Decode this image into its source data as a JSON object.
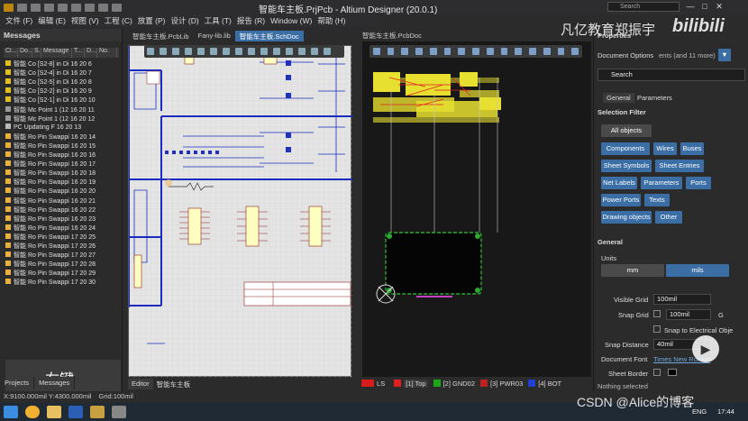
{
  "window": {
    "title": "智能车主板.PrjPcb - Altium Designer (20.0.1)",
    "search_placeholder": "Search",
    "close": "✕",
    "maximize": "□",
    "minimize": "—"
  },
  "menu": [
    "文件 (F)",
    "编辑 (E)",
    "视图 (V)",
    "工程 (C)",
    "放置 (P)",
    "设计 (D)",
    "工具 (T)",
    "报告 (R)",
    "Window (W)",
    "帮助 (H)"
  ],
  "messages": {
    "title": "Messages",
    "columns": [
      "Cl...",
      "Do...",
      "S...",
      "Message",
      "T...",
      "D...",
      "No."
    ],
    "rows": [
      {
        "text": "智能 Co [S2-8] in Di 16 20 6",
        "icon": "yellow-plus"
      },
      {
        "text": "智能 Co [S2-4] in Di 16 20 7",
        "icon": "yellow-plus"
      },
      {
        "text": "智能 Co [S2-5] in Di 16 20 8",
        "icon": "yellow-plus"
      },
      {
        "text": "智能 Co [S2-2] in Di 16 20 9",
        "icon": "yellow-plus"
      },
      {
        "text": "智能 Co [S2-1] in Di 16 20 10",
        "icon": "yellow-plus"
      },
      {
        "text": "智能 Mc Point 1 (12 16 20 11",
        "icon": "grey-dot"
      },
      {
        "text": "智能 Mc Point 1 (12 16 20 12",
        "icon": "grey-dot"
      },
      {
        "text": "PC Updating F 16 20 13",
        "icon": "grey-doc"
      },
      {
        "text": "智能 Ro Pin Swappi 16 20 14",
        "icon": "folder"
      },
      {
        "text": "智能 Ro Pin Swappi 16 20 15",
        "icon": "folder"
      },
      {
        "text": "智能 Ro Pin Swappi 16 20 16",
        "icon": "folder"
      },
      {
        "text": "智能 Ro Pin Swappi 16 20 17",
        "icon": "folder"
      },
      {
        "text": "智能 Ro Pin Swappi 16 20 18",
        "icon": "folder"
      },
      {
        "text": "智能 Ro Pin Swappi 16 20 19",
        "icon": "folder"
      },
      {
        "text": "智能 Ro Pin Swappi 16 20 20",
        "icon": "folder"
      },
      {
        "text": "智能 Ro Pin Swappi 16 20 21",
        "icon": "folder"
      },
      {
        "text": "智能 Ro Pin Swappi 16 20 22",
        "icon": "folder"
      },
      {
        "text": "智能 Ro Pin Swappi 16 20 23",
        "icon": "folder"
      },
      {
        "text": "智能 Ro Pin Swappi 16 20 24",
        "icon": "folder"
      },
      {
        "text": "智能 Ro Pin Swappi 17 20 25",
        "icon": "folder"
      },
      {
        "text": "智能 Ro Pin Swappi 17 20 26",
        "icon": "folder"
      },
      {
        "text": "智能 Ro Pin Swappi 17 20 27",
        "icon": "folder"
      },
      {
        "text": "智能 Ro Pin Swappi 17 20 28",
        "icon": "folder"
      },
      {
        "text": "智能 Ro Pin Swappi 17 20 29",
        "icon": "folder"
      },
      {
        "text": "智能 Ro Pin Swappi 17 20 30",
        "icon": "folder"
      }
    ],
    "overlay_text": "右键",
    "tabs": [
      "Projects",
      "Messages"
    ]
  },
  "doc_tabs": [
    "智能车主板.PcbLib",
    "Fany-lib.lib",
    "智能车主板.SchDoc"
  ],
  "pcb_tab": "智能车主板.PcbDoc",
  "editor_tabs": [
    "Editor",
    "智能车主板"
  ],
  "properties": {
    "header": "Properties",
    "doc_options_label": "Document Options",
    "doc_options_value": "ents (and 11 more)",
    "search_placeholder": "Search",
    "tabs": [
      "General",
      "Parameters"
    ],
    "selection_filter": "Selection Filter",
    "all_objects": "All objects",
    "filters": [
      "Components",
      "Wires",
      "Buses",
      "Sheet Symbols",
      "Sheet Entries",
      "Net Labels",
      "Parameters",
      "Ports",
      "Power Ports",
      "Texts",
      "Drawing objects",
      "Other"
    ],
    "general": "General",
    "units_label": "Units",
    "units": [
      "mm",
      "mils"
    ],
    "visible_grid_label": "Visible Grid",
    "visible_grid": "100mil",
    "snap_grid_label": "Snap Grid",
    "snap_grid": "100mil",
    "snap_grid_key": "G",
    "snap_electrical": "Snap to Electrical Obje",
    "snap_distance_label": "Snap Distance",
    "snap_distance": "40mil",
    "doc_font_label": "Document Font",
    "doc_font": "Times New Roman",
    "sheet_border_label": "Sheet Border",
    "nothing_selected": "Nothing selected"
  },
  "layers": [
    {
      "label": "LS",
      "color": "#d81b1b"
    },
    {
      "label": "[1] Top",
      "color": "#e02020"
    },
    {
      "label": "[2] GND02",
      "color": "#18a818"
    },
    {
      "label": "[3] PWR03",
      "color": "#c02020"
    },
    {
      "label": "[4] BOT",
      "color": "#2040d0"
    }
  ],
  "status": {
    "coords": "X:9100.000mil Y:4300.000mil",
    "grid": "Grid:100mil"
  },
  "taskbar": {
    "lang": "ENG",
    "time": "17:44"
  },
  "watermarks": {
    "top": "凡亿教育郑振宇",
    "bili": "bilibili",
    "bottom": "CSDN @Alice的博客"
  },
  "colors": {
    "accent": "#3a6ea5",
    "panel": "#2b2b2b",
    "schematic_bg": "#e4e4e4",
    "wire_blue": "#1a2bbf",
    "pcb_yellow": "#e8e030",
    "board": "#050505",
    "board_edge": "#2ea82e",
    "pcb_trace_purple": "#c040c0"
  }
}
